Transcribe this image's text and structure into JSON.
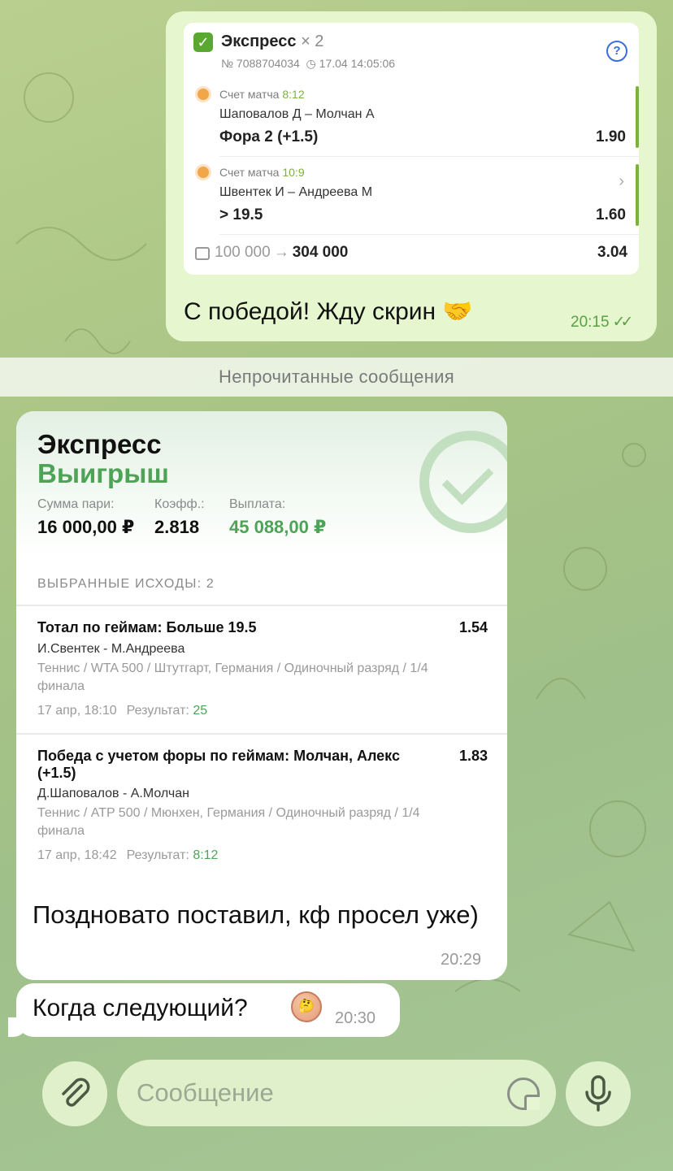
{
  "outgoing_message": {
    "bet_card": {
      "title": "Экспресс",
      "multiplier": "× 2",
      "bet_number": "№ 7088704034",
      "datetime": "17.04 14:05:06",
      "events": [
        {
          "score_label": "Счет матча",
          "score": "8:12",
          "teams": "Шаповалов Д – Молчан А",
          "market": "Фора 2 (+1.5)",
          "odds": "1.90"
        },
        {
          "score_label": "Счет матча",
          "score": "10:9",
          "teams": "Швентек И – Андреева М",
          "market": "> 19.5",
          "odds": "1.60"
        }
      ],
      "stake": "100 000",
      "payout": "304 000",
      "total_odds": "3.04"
    },
    "text": "С победой! Жду скрин 🤝",
    "time": "20:15",
    "read_marks": "✓✓"
  },
  "unread_divider": "Непрочитанные сообщения",
  "incoming_message": {
    "title": "Экспресс",
    "status": "Выигрыш",
    "stake_label": "Сумма пари:",
    "stake_value": "16 000,00 ₽",
    "odds_label": "Коэфф.:",
    "odds_value": "2.818",
    "payout_label": "Выплата:",
    "payout_value": "45 088,00 ₽",
    "selections_header": "ВЫБРАННЫЕ ИСХОДЫ: 2",
    "selections": [
      {
        "market": "Тотал по геймам: Больше 19.5",
        "odds": "1.54",
        "teams": "И.Свентек - М.Андреева",
        "league": "Теннис / WTA 500 / Штутгарт, Германия / Одиночный разряд / 1/4 финала",
        "time": "17 апр, 18:10",
        "result_label": "Результат:",
        "result": "25"
      },
      {
        "market": "Победа с учетом форы по геймам: Молчан, Алекс (+1.5)",
        "odds": "1.83",
        "teams": "Д.Шаповалов - А.Молчан",
        "league": "Теннис / ATP 500 / Мюнхен, Германия / Одиночный разряд / 1/4 финала",
        "time": "17 апр, 18:42",
        "result_label": "Результат:",
        "result": "8:12"
      }
    ],
    "text": "Поздновато поставил, кф просел уже)",
    "time": "20:29"
  },
  "incoming_message_2": {
    "text": "Когда следующий?",
    "emoji": "🤔",
    "time": "20:30"
  },
  "composer": {
    "placeholder": "Сообщение"
  },
  "colors": {
    "accent_green": "#4da356",
    "outgoing_bubble": "#e6f7cf",
    "wallpaper": "#a9c585"
  }
}
